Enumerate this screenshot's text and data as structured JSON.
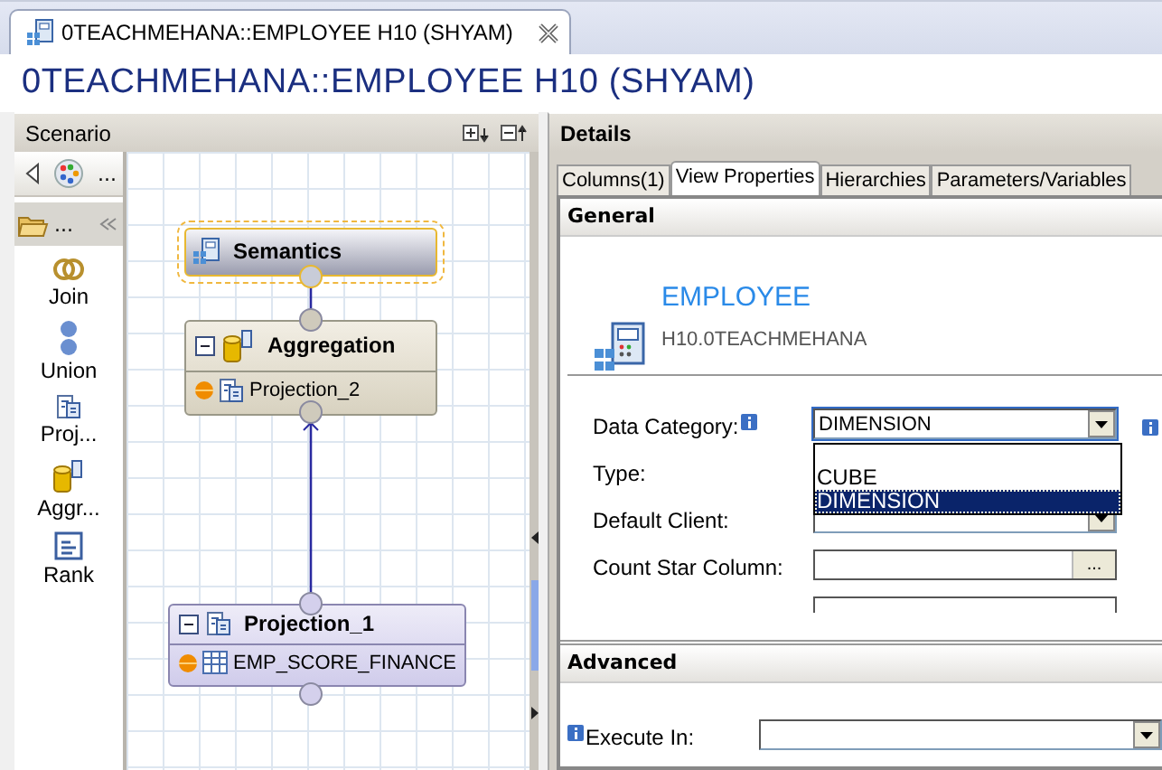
{
  "editor_tab": {
    "title": "0TEACHMEHANA::EMPLOYEE H10 (SHYAM)",
    "selected": true
  },
  "title": "0TEACHMEHANA::EMPLOYEE H10 (SHYAM)",
  "scenario": {
    "title": "Scenario",
    "toolbar_more": "...",
    "folder_label": "...",
    "palette": [
      {
        "kind": "join",
        "label": "Join"
      },
      {
        "kind": "union",
        "label": "Union"
      },
      {
        "kind": "projection",
        "label": "Proj..."
      },
      {
        "kind": "aggregation",
        "label": "Aggr..."
      },
      {
        "kind": "rank",
        "label": "Rank"
      }
    ],
    "nodes": [
      {
        "kind": "semantics",
        "title": "Semantics",
        "selected": true
      },
      {
        "kind": "aggregation",
        "title": "Aggregation",
        "selected": false,
        "input": "Projection_2"
      },
      {
        "kind": "projection",
        "title": "Projection_1",
        "selected": false,
        "input": "EMP_SCORE_FINANCE"
      }
    ]
  },
  "details": {
    "title": "Details",
    "tabs": [
      {
        "label": "Columns(1)",
        "selected": false
      },
      {
        "label": "View Properties",
        "selected": true
      },
      {
        "label": "Hierarchies",
        "selected": false
      },
      {
        "label": "Parameters/Variables",
        "selected": false
      }
    ],
    "general": {
      "title": "General",
      "name": "EMPLOYEE",
      "schema": "H10.0TEACHMEHANA",
      "fields": [
        {
          "kind": "dropdown",
          "label": "Data Category:",
          "info": true,
          "value": "DIMENSION",
          "expanded": true,
          "options": [
            {
              "label": "CUBE",
              "selected": false
            },
            {
              "label": "DIMENSION",
              "selected": true
            }
          ]
        },
        {
          "kind": "hidden",
          "label": "Type:"
        },
        {
          "kind": "dropdown",
          "label": "Default Client:"
        },
        {
          "kind": "picker",
          "label": "Count Star Column:",
          "button": "..."
        },
        {
          "kind": "cut"
        }
      ]
    },
    "advanced": {
      "title": "Advanced",
      "fields": [
        {
          "kind": "dropdown",
          "label": "Execute In:",
          "info": true
        }
      ]
    }
  }
}
